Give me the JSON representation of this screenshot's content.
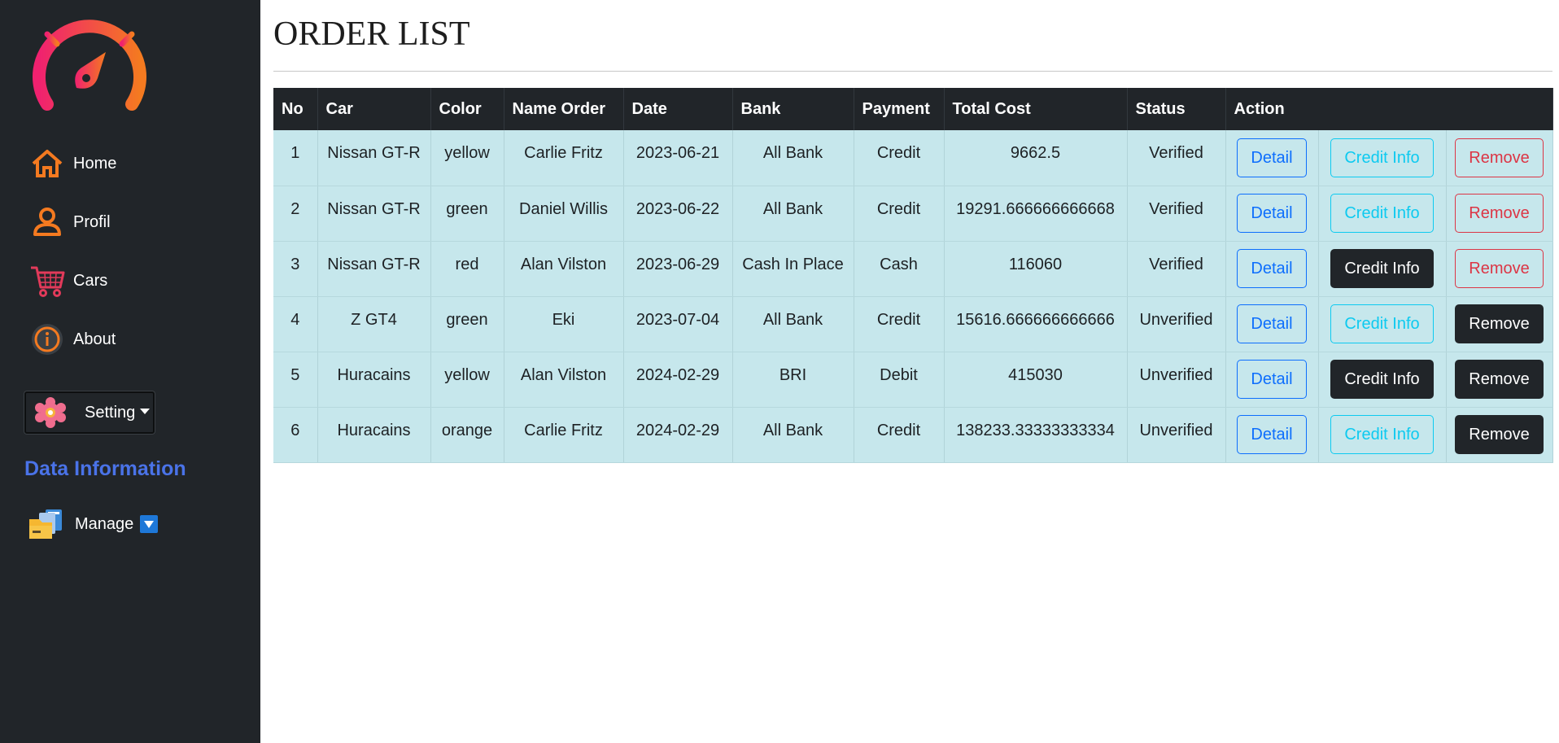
{
  "sidebar": {
    "nav": [
      {
        "label": "Home",
        "icon": "home-icon"
      },
      {
        "label": "Profil",
        "icon": "user-icon"
      },
      {
        "label": "Cars",
        "icon": "cart-icon"
      },
      {
        "label": "About",
        "icon": "info-icon"
      }
    ],
    "setting_label": "Setting",
    "section_title": "Data Information",
    "manage_label": "Manage"
  },
  "main": {
    "title": "ORDER LIST",
    "columns": [
      "No",
      "Car",
      "Color",
      "Name Order",
      "Date",
      "Bank",
      "Payment",
      "Total Cost",
      "Status",
      "Action"
    ],
    "action_labels": {
      "detail": "Detail",
      "credit_info": "Credit Info",
      "remove": "Remove"
    },
    "rows": [
      {
        "no": "1",
        "car": "Nissan GT-R",
        "color": "yellow",
        "name": "Carlie Fritz",
        "date": "2023-06-21",
        "bank": "All Bank",
        "payment": "Credit",
        "total": "9662.5",
        "status": "Verified",
        "credit_style": "outline",
        "remove_style": "outline"
      },
      {
        "no": "2",
        "car": "Nissan GT-R",
        "color": "green",
        "name": "Daniel Willis",
        "date": "2023-06-22",
        "bank": "All Bank",
        "payment": "Credit",
        "total": "19291.666666666668",
        "status": "Verified",
        "credit_style": "outline",
        "remove_style": "outline"
      },
      {
        "no": "3",
        "car": "Nissan GT-R",
        "color": "red",
        "name": "Alan Vilston",
        "date": "2023-06-29",
        "bank": "Cash In Place",
        "payment": "Cash",
        "total": "116060",
        "status": "Verified",
        "credit_style": "dark",
        "remove_style": "outline"
      },
      {
        "no": "4",
        "car": "Z GT4",
        "color": "green",
        "name": "Eki",
        "date": "2023-07-04",
        "bank": "All Bank",
        "payment": "Credit",
        "total": "15616.666666666666",
        "status": "Unverified",
        "credit_style": "outline",
        "remove_style": "dark"
      },
      {
        "no": "5",
        "car": "Huracains",
        "color": "yellow",
        "name": "Alan Vilston",
        "date": "2024-02-29",
        "bank": "BRI",
        "payment": "Debit",
        "total": "415030",
        "status": "Unverified",
        "credit_style": "dark",
        "remove_style": "dark"
      },
      {
        "no": "6",
        "car": "Huracains",
        "color": "orange",
        "name": "Carlie Fritz",
        "date": "2024-02-29",
        "bank": "All Bank",
        "payment": "Credit",
        "total": "138233.33333333334",
        "status": "Unverified",
        "credit_style": "outline",
        "remove_style": "dark"
      }
    ]
  },
  "colors": {
    "sidebar_bg": "#212529",
    "row_bg": "#c6e7ec",
    "accent_orange": "#f47a20",
    "accent_pink": "#f0216f",
    "section_title": "#4a73e8"
  }
}
